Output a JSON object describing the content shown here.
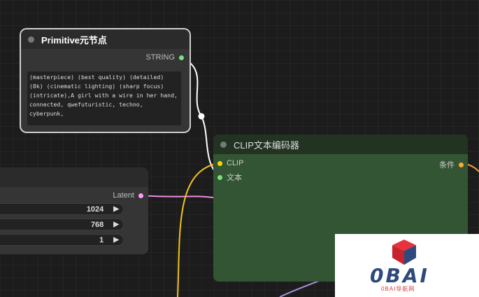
{
  "nodes": {
    "primitive": {
      "title": "Primitive元节点",
      "output_label": "STRING",
      "output_color": "#7fe07f",
      "text": "(masterpiece) (best quality) (detailed) (8k) (cinematic lighting) (sharp focus) (intricate),A girl with a wire in her hand, connected, qwefuturistic, techno, cyberpunk,"
    },
    "latent": {
      "output_label": "Latent",
      "output_color": "#ff9cf9",
      "widgets": [
        {
          "value": "1024"
        },
        {
          "value": "768"
        },
        {
          "value": "1"
        }
      ]
    },
    "clip": {
      "title": "CLIP文本编码器",
      "inputs": [
        {
          "label": "CLIP",
          "color": "#ffd500"
        },
        {
          "label": "文本",
          "color": "#7fe07f"
        }
      ],
      "output_label": "条件",
      "output_color": "#ffa931",
      "body_color": "#335533"
    }
  },
  "watermark": {
    "text": "0BAI",
    "subtitle": "0BAI导航网"
  }
}
